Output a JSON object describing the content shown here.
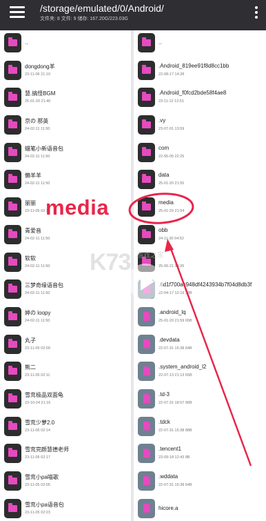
{
  "header": {
    "path": "/storage/emulated/0/Android/",
    "stats": "文件夹: 8   文件: 9   储存: 167.20G/223.03G"
  },
  "left": [
    {
      "name": "..",
      "meta": "",
      "type": "folder"
    },
    {
      "name": "dongdong羊",
      "meta": "23-11-06 21:10",
      "type": "folder"
    },
    {
      "name": "慧.搞怪BGM",
      "meta": "25-01-20 21:40",
      "type": "folder"
    },
    {
      "name": "京の 那英",
      "meta": "24-02-11 11:50",
      "type": "folder"
    },
    {
      "name": "蜡笔小新语音包",
      "meta": "24-02-11 11:50",
      "type": "folder"
    },
    {
      "name": "懒羊羊",
      "meta": "24-02-11 11:50",
      "type": "folder"
    },
    {
      "name": "丽丽",
      "meta": "23-11-05 02:16",
      "type": "folder"
    },
    {
      "name": "青爱音",
      "meta": "24-02-11 11:50",
      "type": "folder"
    },
    {
      "name": "软软",
      "meta": "24-02-11 11:50",
      "type": "folder"
    },
    {
      "name": "三梦奇缘语音包",
      "meta": "24-02-11 11:50",
      "type": "folder"
    },
    {
      "name": "婷の loopy",
      "meta": "24-02-11 11:50",
      "type": "folder"
    },
    {
      "name": "丸子",
      "meta": "23-11-05 02:09",
      "type": "folder"
    },
    {
      "name": "熊二",
      "meta": "23-11-05 02:11",
      "type": "folder"
    },
    {
      "name": "雪㐬极品双面龟",
      "meta": "23-10-24 21:15",
      "type": "folder"
    },
    {
      "name": "雪㐬少萝2.0",
      "meta": "23-11-05 02:14",
      "type": "folder"
    },
    {
      "name": "雪㐬完颜慧德老师",
      "meta": "23-11-05 02:17",
      "type": "folder"
    },
    {
      "name": "雪㐬小pa喵歌",
      "meta": "23-11-05 02:05",
      "type": "folder"
    },
    {
      "name": "雪㐬小pa语音包",
      "meta": "23-11-05 02:23",
      "type": "folder"
    }
  ],
  "right": [
    {
      "name": "..",
      "meta": "",
      "type": "folder"
    },
    {
      "name": ".Android_819ee91f8d8cc1bb",
      "meta": "22-08-17 14:28",
      "type": "folder"
    },
    {
      "name": ".Android_f0fcd2bde58f4ae8",
      "meta": "23-11-12 12:51",
      "type": "folder"
    },
    {
      "name": ".vy",
      "meta": "23-07-01 13:59",
      "type": "folder"
    },
    {
      "name": "com",
      "meta": "22-05-05 22:25",
      "type": "folder"
    },
    {
      "name": "data",
      "meta": "25-01-20 21:55",
      "type": "folder"
    },
    {
      "name": "media",
      "meta": "25-01-20 21:54",
      "type": "folder"
    },
    {
      "name": "obb",
      "meta": "24-11-30 04:52",
      "type": "folder"
    },
    {
      "name": "",
      "meta": "25-06-21 18:26",
      "type": "folder"
    },
    {
      "name": ".6d1f700ac948df4243934b7f04d8db3f",
      "meta": "22-04-17 12:19   33B",
      "type": "file"
    },
    {
      "name": ".android_lq",
      "meta": "25-01-20 21:59   65B",
      "type": "file"
    },
    {
      "name": ".devdata",
      "meta": "22-07-31 15:38   64B",
      "type": "file"
    },
    {
      "name": ".system_android_l2",
      "meta": "22-07-13 21:13   65B",
      "type": "file"
    },
    {
      "name": ".td-3",
      "meta": "22-07-31 18:57   96B",
      "type": "file"
    },
    {
      "name": ".tdck",
      "meta": "22-07-31 15:38   88B",
      "type": "file"
    },
    {
      "name": ".tencent1",
      "meta": "23-09-18 12:43   8B",
      "type": "file"
    },
    {
      "name": ".wddata",
      "meta": "22-07-31 15:38   64B",
      "type": "file"
    },
    {
      "name": "hicore.a",
      "meta": "",
      "type": "file"
    }
  ],
  "annotation": {
    "label": "media",
    "color": "#e8264a"
  },
  "watermark": {
    "logo": "K73",
    "sub": "游戏之家"
  },
  "colors": {
    "appbar": "#2f2f33",
    "folder_accent": "#e64ac0",
    "file_icon_bg": "#6f8190"
  }
}
